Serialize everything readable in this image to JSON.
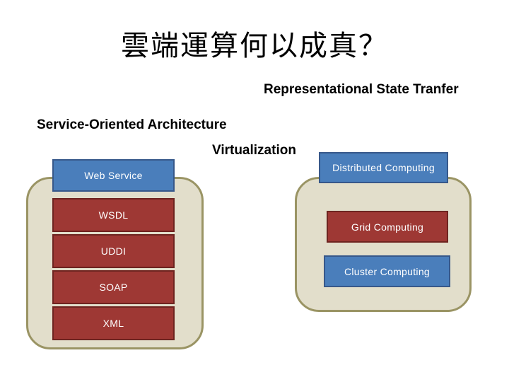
{
  "slide": {
    "title": "雲端運算何以成真？",
    "background_color": "#ffffff"
  },
  "labels": {
    "rest": "Representational State Tranfer",
    "soa": "Service-Oriented Architecture",
    "virtualization": "Virtualization"
  },
  "palette": {
    "blue_fill": "#4a7ebb",
    "blue_border": "#37588a",
    "red_fill": "#9e3834",
    "red_border": "#6e2420",
    "group_fill": "#e2decb",
    "group_border": "#9a9464",
    "text_on_box": "#ffffff",
    "text_label": "#000000"
  },
  "groups": {
    "soa_stack": {
      "items": [
        {
          "label": "Web Service",
          "color": "blue"
        },
        {
          "label": "WSDL",
          "color": "red"
        },
        {
          "label": "UDDI",
          "color": "red"
        },
        {
          "label": "SOAP",
          "color": "red"
        },
        {
          "label": "XML",
          "color": "red"
        }
      ]
    },
    "distributed_stack": {
      "items": [
        {
          "label": "Distributed Computing",
          "color": "blue"
        },
        {
          "label": "Grid Computing",
          "color": "red"
        },
        {
          "label": "Cluster Computing",
          "color": "blue"
        }
      ]
    }
  }
}
